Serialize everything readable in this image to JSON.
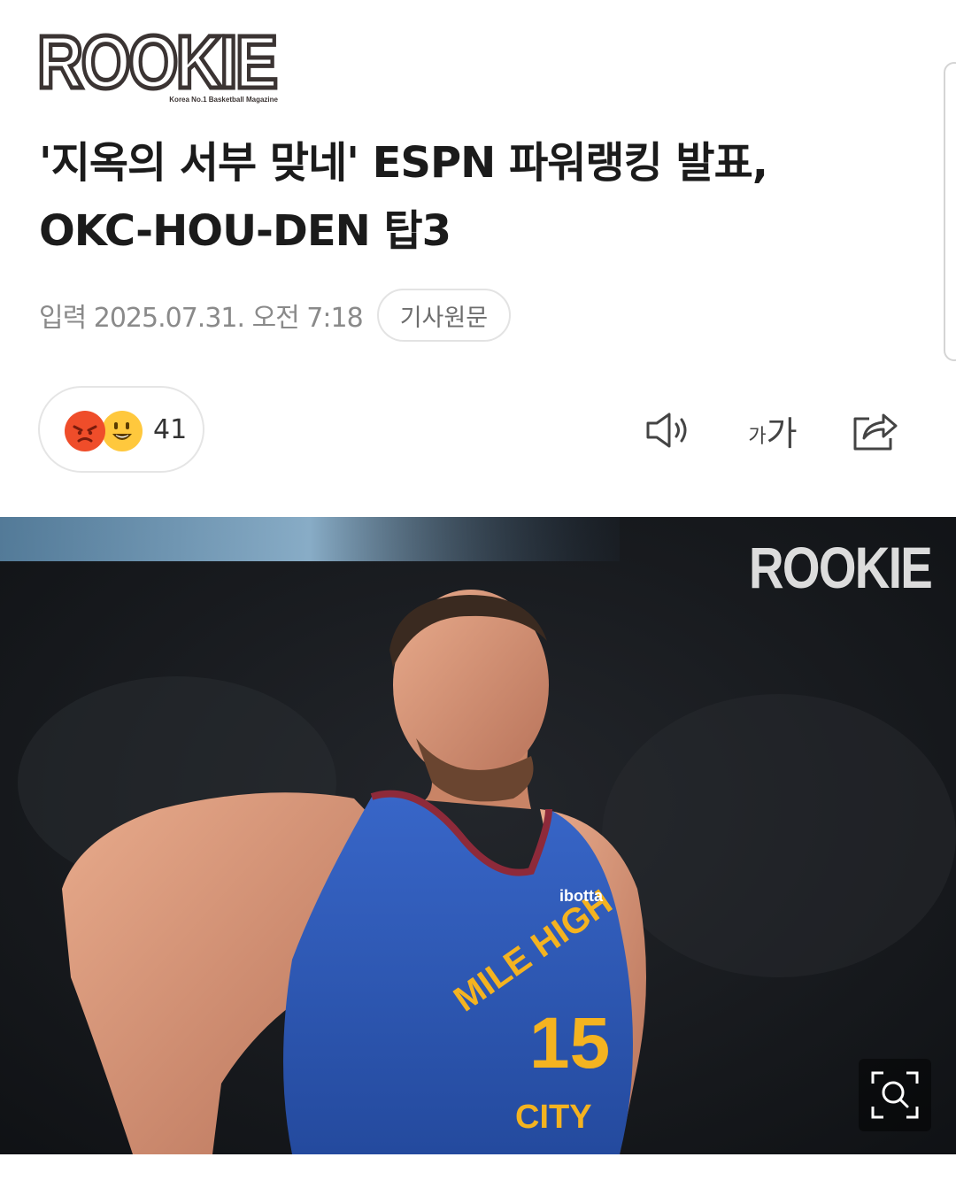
{
  "brand": {
    "logo_text": "ROOKIE",
    "logo_tagline": "Korea No.1 Basketball Magazine"
  },
  "article": {
    "title_line1": "'지옥의 서부 맞네' ESPN 파워랭킹 발표,",
    "title_line2": "OKC-HOU-DEN 탑3",
    "date": "입력 2025.07.31. 오전 7:18",
    "original_button": "기사원문"
  },
  "reactions": {
    "count": "41",
    "emojis": [
      "angry-face-icon",
      "laughing-face-icon"
    ]
  },
  "toolbar": {
    "font_small": "가",
    "font_big": "가",
    "icons": [
      "speaker-icon",
      "font-size-icon",
      "share-icon"
    ]
  },
  "photo": {
    "watermark": "ROOKIE",
    "jersey_text": "MILE HIGH",
    "jersey_city": "CITY",
    "jersey_number": "15",
    "sponsor": "ibotta",
    "zoom_icon": "zoom-icon"
  },
  "colors": {
    "headline": "#1b1b1b",
    "meta_gray": "#8a8a8a",
    "jersey_blue": "#2f5ab8",
    "jersey_gold": "#f4b320",
    "jersey_trim": "#8e2a3a",
    "angry": "#ef4d2a",
    "laugh": "#ffc83d"
  }
}
